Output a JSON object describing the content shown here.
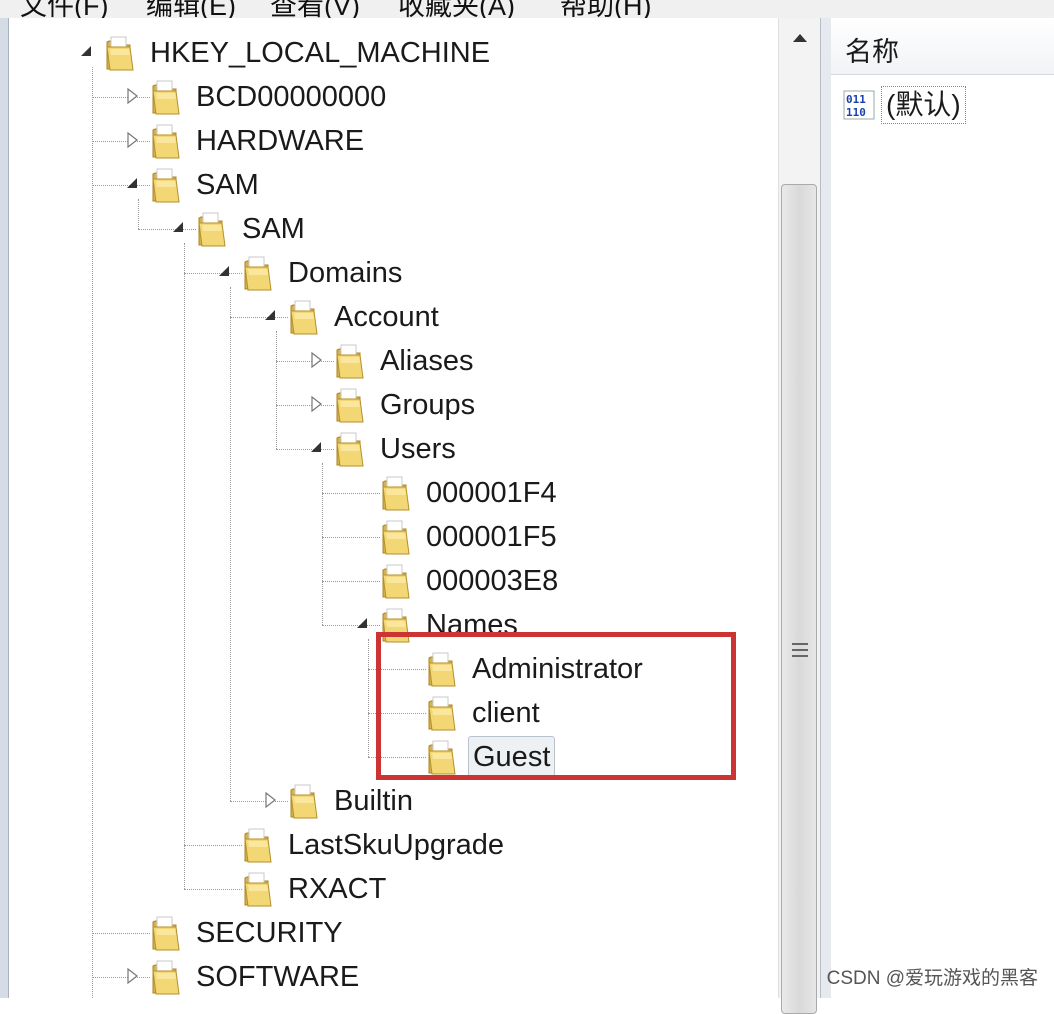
{
  "menu": [
    {
      "label": "文件(F)"
    },
    {
      "label": "编辑(E)"
    },
    {
      "label": "查看(V)"
    },
    {
      "label": "收藏夹(A)"
    },
    {
      "label": "帮助(H)"
    }
  ],
  "tree": [
    {
      "label": "HKEY_LOCAL_MACHINE",
      "level": 0,
      "toggle": "expanded",
      "selected": false
    },
    {
      "label": "BCD00000000",
      "level": 1,
      "toggle": "collapsed",
      "selected": false
    },
    {
      "label": "HARDWARE",
      "level": 1,
      "toggle": "collapsed",
      "selected": false
    },
    {
      "label": "SAM",
      "level": 1,
      "toggle": "expanded",
      "selected": false
    },
    {
      "label": "SAM",
      "level": 2,
      "toggle": "expanded",
      "selected": false
    },
    {
      "label": "Domains",
      "level": 3,
      "toggle": "expanded",
      "selected": false
    },
    {
      "label": "Account",
      "level": 4,
      "toggle": "expanded",
      "selected": false
    },
    {
      "label": "Aliases",
      "level": 5,
      "toggle": "collapsed",
      "selected": false
    },
    {
      "label": "Groups",
      "level": 5,
      "toggle": "collapsed",
      "selected": false
    },
    {
      "label": "Users",
      "level": 5,
      "toggle": "expanded",
      "selected": false
    },
    {
      "label": "000001F4",
      "level": 6,
      "toggle": "none",
      "selected": false
    },
    {
      "label": "000001F5",
      "level": 6,
      "toggle": "none",
      "selected": false
    },
    {
      "label": "000003E8",
      "level": 6,
      "toggle": "none",
      "selected": false
    },
    {
      "label": "Names",
      "level": 6,
      "toggle": "expanded",
      "selected": false
    },
    {
      "label": "Administrator",
      "level": 7,
      "toggle": "none",
      "selected": false
    },
    {
      "label": "client",
      "level": 7,
      "toggle": "none",
      "selected": false
    },
    {
      "label": "Guest",
      "level": 7,
      "toggle": "none",
      "selected": true
    },
    {
      "label": "Builtin",
      "level": 4,
      "toggle": "collapsed",
      "selected": false
    },
    {
      "label": "LastSkuUpgrade",
      "level": 3,
      "toggle": "none",
      "selected": false
    },
    {
      "label": "RXACT",
      "level": 3,
      "toggle": "none",
      "selected": false
    },
    {
      "label": "SECURITY",
      "level": 1,
      "toggle": "none",
      "selected": false
    },
    {
      "label": "SOFTWARE",
      "level": 1,
      "toggle": "collapsed",
      "selected": false
    }
  ],
  "values_pane": {
    "column_name": "名称",
    "rows": [
      {
        "icon": "registry-binary-value-icon",
        "name": "(默认)"
      }
    ]
  },
  "annotation": {
    "color": "#cc3333"
  },
  "watermark": "CSDN @爱玩游戏的黑客"
}
